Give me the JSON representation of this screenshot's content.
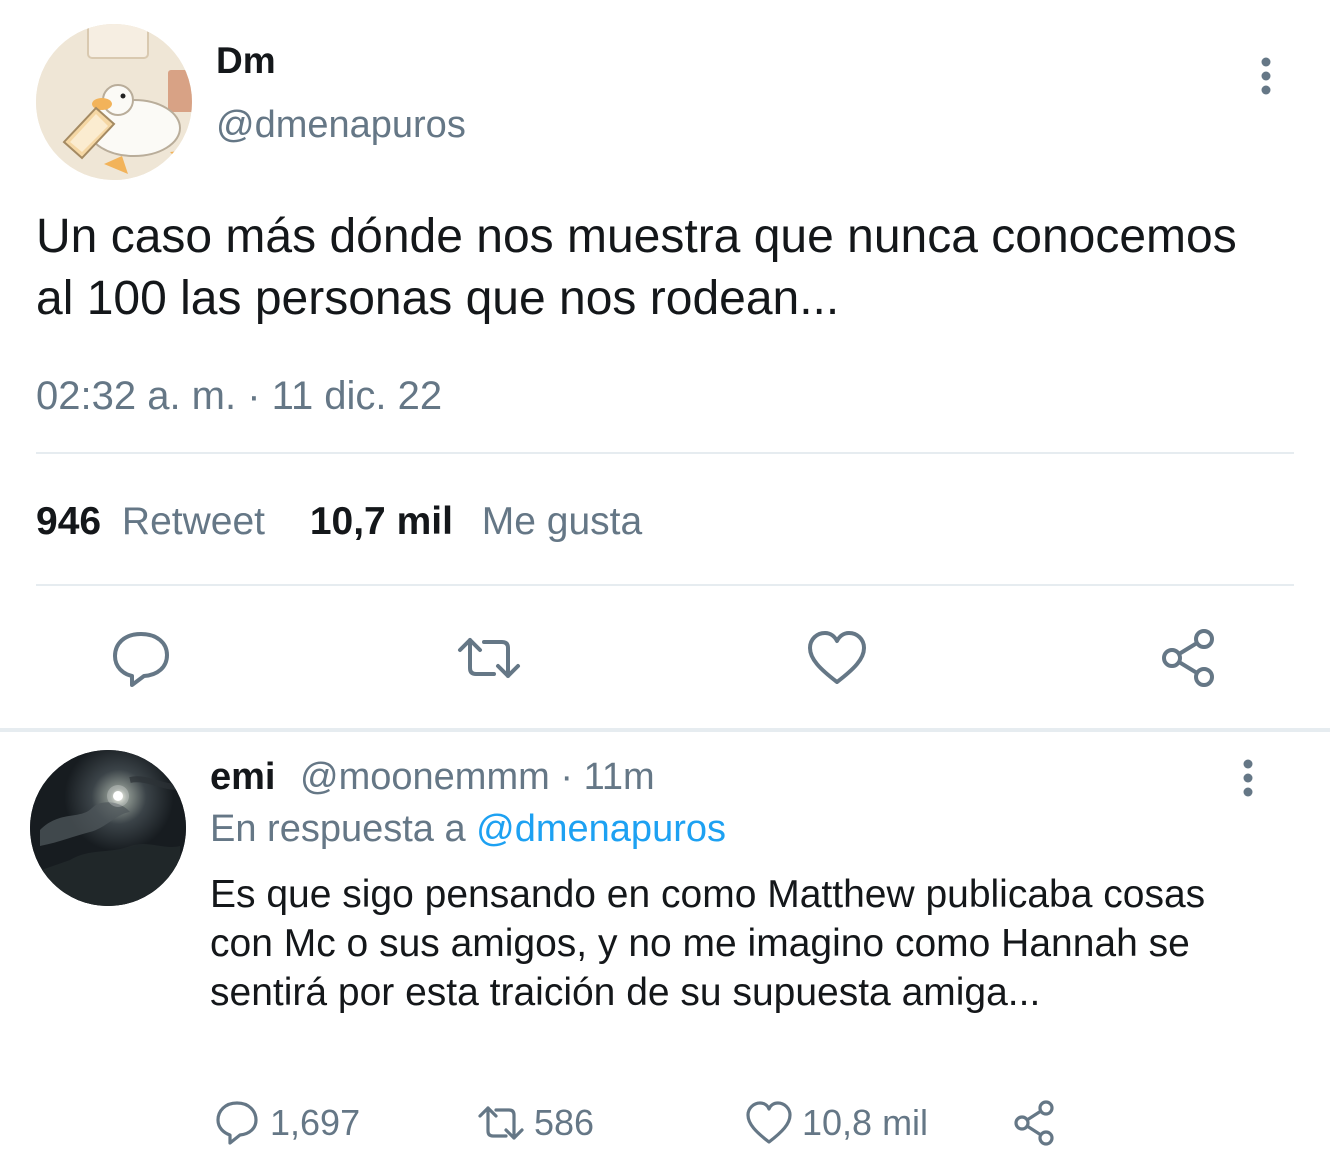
{
  "main_tweet": {
    "author": {
      "display_name": "Dm",
      "handle": "@dmenapuros"
    },
    "text": "Un caso más dónde nos muestra que nunca conocemos al 100 las personas que nos rodean...",
    "timestamp": "02:32 a. m. · 11 dic. 22",
    "stats": {
      "retweets_count": "946",
      "retweets_label": "Retweet",
      "likes_count": "10,7 mil",
      "likes_label": "Me gusta"
    },
    "actions": [
      "reply-icon",
      "retweet-icon",
      "like-icon",
      "share-icon"
    ]
  },
  "reply": {
    "author": {
      "display_name": "emi",
      "handle": "@moonemmm"
    },
    "separator": "·",
    "time_ago": "11m",
    "replying_to_label": "En respuesta a",
    "replying_to_mention": "@dmenapuros",
    "text": "Es que sigo pensando en como Matthew publicaba cosas con Mc o sus amigos, y no me imagino como Hannah se sentirá por esta traición de su supuesta amiga...",
    "counts": {
      "replies": "1,697",
      "retweets": "586",
      "likes": "10,8 mil"
    }
  },
  "colors": {
    "text_primary": "#14171a",
    "text_secondary": "#657786",
    "link": "#1da1f2",
    "divider": "#e6ecf0"
  }
}
